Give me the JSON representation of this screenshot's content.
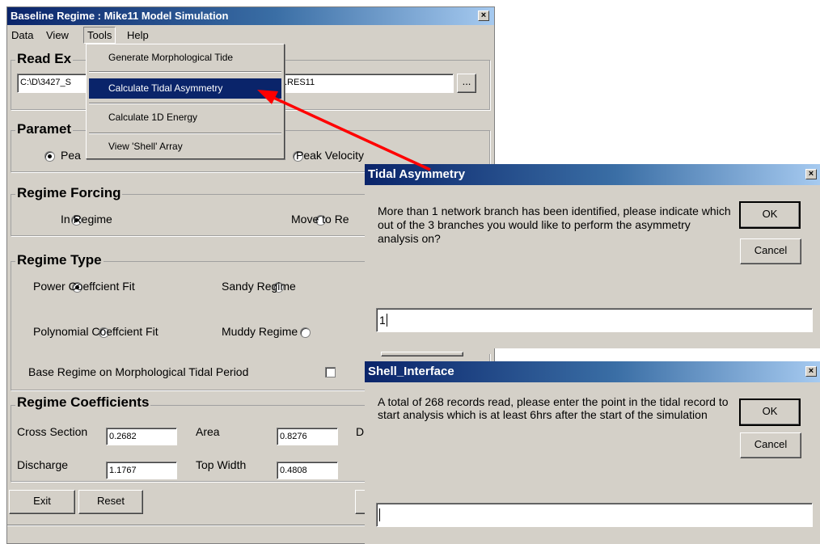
{
  "main_window": {
    "title": "Baseline Regime : Mike11 Model Simulation",
    "close_glyph": "×",
    "menu": [
      "Data",
      "View",
      "Tools",
      "Help"
    ],
    "read_group": {
      "title": "Read Ex",
      "path_left": "C:\\D\\3427_S",
      "path_right": ".RES11",
      "browse_label": "..."
    },
    "param_group": {
      "title": "Paramet",
      "opt1": "Pea",
      "opt2": "Peak Velocity"
    },
    "forcing_group": {
      "title": "Regime Forcing",
      "opt1": "In Regime",
      "opt2": "Move to Re"
    },
    "type_group": {
      "title": "Regime Type",
      "opt_power": "Power Coeffcient Fit",
      "opt_sandy": "Sandy Regime",
      "opt_poly": "Polynomial Coeffcient Fit",
      "opt_muddy": "Muddy Regime",
      "base_label": "Base Regime on Morphological Tidal Period"
    },
    "coeff_group": {
      "title": "Regime Coefficients",
      "cross_section_label": "Cross Section",
      "cross_section_value": "0.2682",
      "area_label": "Area",
      "area_value": "0.8276",
      "d_label": "D",
      "discharge_label": "Discharge",
      "discharge_value": "1.1767",
      "top_width_label": "Top Width",
      "top_width_value": "0.4808"
    },
    "exit_label": "Exit",
    "reset_label": "Reset"
  },
  "tools_menu": {
    "items": [
      "Generate Morphological Tide",
      "Calculate Tidal Asymmetry",
      "Calculate 1D Energy",
      "View 'Shell' Array"
    ],
    "selected_index": 1
  },
  "tidal_dialog": {
    "title": "Tidal Asymmetry",
    "close_glyph": "×",
    "message": "More than 1 network branch has been identified, please indicate which out of the 3 branches you would like to perform the asymmetry analysis on?",
    "input_value": "1",
    "ok_label": "OK",
    "cancel_label": "Cancel"
  },
  "shell_dialog": {
    "title": "Shell_Interface",
    "close_glyph": "×",
    "message": "A total of 268  records read, please enter the point in the tidal record to start analysis which is at least 6hrs after the start of the simulation",
    "input_value": "",
    "ok_label": "OK",
    "cancel_label": "Cancel"
  },
  "colors": {
    "face": "#d4d0c8",
    "title_blue": "#0a246a",
    "menu_highlight": "#0a246a",
    "arrow": "#ff0000"
  }
}
